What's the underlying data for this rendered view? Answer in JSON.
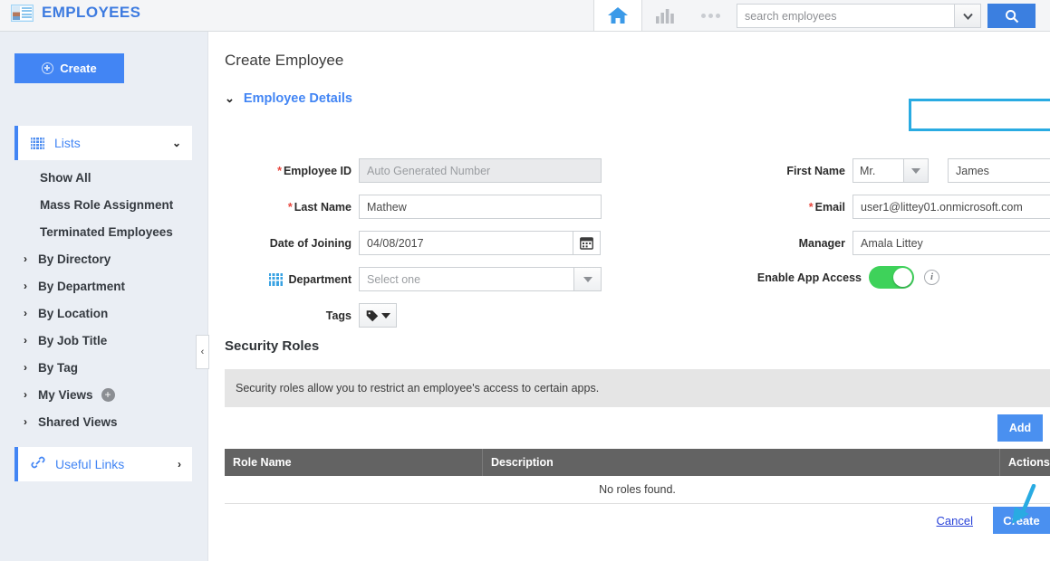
{
  "app": {
    "title": "EMPLOYEES",
    "brand_icon": "id-card-icon",
    "brand_color": "#3d7be0"
  },
  "topbar": {
    "home_icon": "home-icon",
    "reports_icon": "bar-chart-icon",
    "more_icon": "ellipsis-icon",
    "search": {
      "placeholder": "search employees",
      "value": "",
      "dropdown_icon": "chevron-down-icon",
      "button_icon": "search-icon"
    }
  },
  "sidebar": {
    "create_button": "Create",
    "create_icon": "plus-circle-icon",
    "lists": {
      "label": "Lists",
      "icon": "grid-icon",
      "chevron": "chevron-down-icon",
      "active": true
    },
    "items": [
      {
        "label": "Show All",
        "arrow": false
      },
      {
        "label": "Mass Role Assignment",
        "arrow": false
      },
      {
        "label": "Terminated Employees",
        "arrow": false
      },
      {
        "label": "By Directory",
        "arrow": true
      },
      {
        "label": "By Department",
        "arrow": true
      },
      {
        "label": "By Location",
        "arrow": true
      },
      {
        "label": "By Job Title",
        "arrow": true
      },
      {
        "label": "By Tag",
        "arrow": true
      },
      {
        "label": "My Views",
        "arrow": true,
        "badge": "+"
      },
      {
        "label": "Shared Views",
        "arrow": true
      }
    ],
    "useful_links": {
      "label": "Useful Links",
      "icon": "link-icon",
      "chevron": "chevron-right-icon"
    },
    "collapse_handle": "‹"
  },
  "main": {
    "page_title": "Create Employee",
    "section": {
      "label": "Employee Details",
      "chevron": "chevron-down-icon"
    },
    "fields": {
      "employee_id": {
        "label": "Employee ID",
        "required": true,
        "placeholder": "Auto Generated Number",
        "value": "",
        "readonly": true
      },
      "last_name": {
        "label": "Last Name",
        "required": true,
        "value": "Mathew"
      },
      "date_of_joining": {
        "label": "Date of Joining",
        "required": false,
        "value": "04/08/2017",
        "icon": "calendar-icon"
      },
      "department": {
        "label": "Department",
        "required": false,
        "placeholder": "Select one",
        "value": "",
        "icon": "building-icon",
        "caret": "caret-down-icon"
      },
      "tags": {
        "label": "Tags",
        "icon": "tag-icon",
        "caret": "caret-down-icon"
      },
      "first_name": {
        "label": "First Name",
        "required": false,
        "prefix_value": "Mr.",
        "value": "James"
      },
      "email": {
        "label": "Email",
        "required": true,
        "value": "user1@littey01.onmicrosoft.com",
        "highlighted": true,
        "highlight_color": "#29abe2"
      },
      "manager": {
        "label": "Manager",
        "required": false,
        "value": "Amala Littey",
        "icon": "search-icon"
      },
      "enable_app_access": {
        "label": "Enable App Access",
        "state": "on",
        "toggle_color": "#3ed25a",
        "info_icon": "info-icon"
      }
    },
    "security_roles": {
      "title": "Security Roles",
      "note": "Security roles allow you to restrict an employee's access to certain apps.",
      "add_button": "Add",
      "columns": [
        "Role Name",
        "Description",
        "Actions"
      ],
      "rows": [],
      "empty_message": "No roles found."
    },
    "footer": {
      "cancel": "Cancel",
      "create": "Create"
    },
    "annotation": {
      "type": "arrow",
      "color": "#29abe2",
      "points_to": "create-submit-button"
    }
  }
}
